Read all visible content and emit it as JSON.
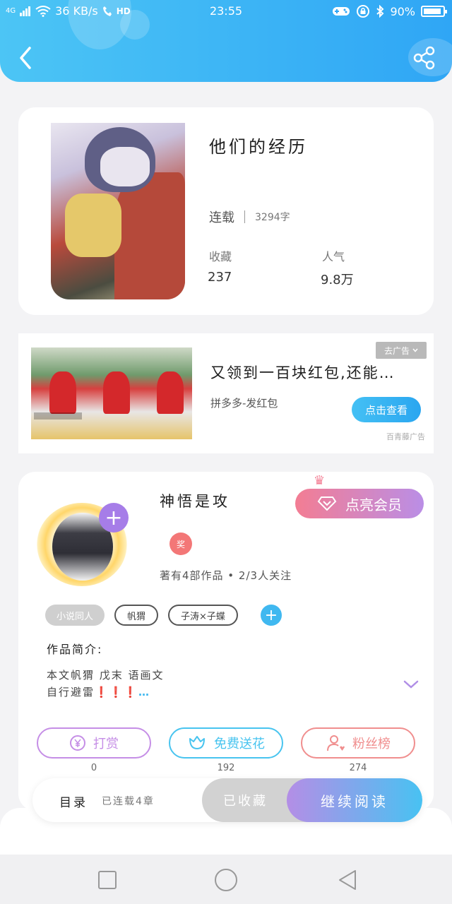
{
  "status_bar": {
    "signal": "4G",
    "net_speed": "36 KB/s",
    "hd": "HD",
    "time": "23:55",
    "battery": "90%"
  },
  "header": {
    "back_icon": "chevron-left-icon",
    "share_icon": "share-icon"
  },
  "book": {
    "title": "他们的经历",
    "status": "连载",
    "word_count": "3294字",
    "favorites_label": "收藏",
    "favorites_value": "237",
    "popularity_label": "人气",
    "popularity_value": "9.8万"
  },
  "ad": {
    "tag": "去广告",
    "title": "又领到一百块红包,还能…",
    "subtitle": "拼多多-发红包",
    "button": "点击查看",
    "source": "百青藤广告",
    "images": [
      "ad-image-1",
      "ad-image-2",
      "ad-image-3"
    ]
  },
  "author": {
    "name": "神悟是攻",
    "vip_button": "点亮会员",
    "level_badge": "奖",
    "meta": "著有4部作品 • 2/3人关注",
    "tags": [
      "小说同人",
      "帆猬",
      "子涛×子蝶"
    ],
    "intro_label": "作品简介:",
    "intro_line1": "本文帆猬 戊末 语画文",
    "intro_line2_prefix": "自行避雷",
    "intro_line2_suffix": "❗❗❗…"
  },
  "actions": [
    {
      "label": "打赏",
      "count": "0",
      "icon": "yen-icon",
      "color": "#c58ee6"
    },
    {
      "label": "免费送花",
      "count": "192",
      "icon": "flower-icon",
      "color": "#48c4ef"
    },
    {
      "label": "粉丝榜",
      "count": "274",
      "icon": "fan-ranking-icon",
      "color": "#f08e8e"
    }
  ],
  "bottom_bar": {
    "toc": "目录",
    "toc_sub": "已连载4章",
    "collected": "已收藏",
    "continue": "继续阅读"
  },
  "colors": {
    "header_start": "#4cc5f5",
    "header_end": "#2fa6f5",
    "vip_start": "#f37d93",
    "vip_end": "#ba8ee6"
  }
}
